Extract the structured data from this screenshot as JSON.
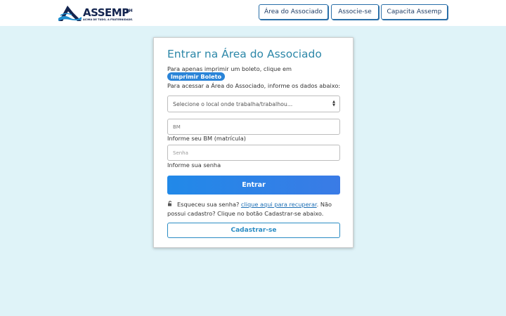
{
  "header": {
    "logo": {
      "wordmark": "ASSEMP",
      "suffix": "BH",
      "tagline": "ACIMA DE TUDO, A FRATERNIDADE."
    },
    "nav": [
      "Área do Associado",
      "Associe-se",
      "Capacita Assemp"
    ]
  },
  "login": {
    "title": "Entrar na Área do Associado",
    "boleto_prompt": "Para apenas imprimir um boleto, clique em",
    "boleto_button": "Imprimir Boleto",
    "access_prompt": "Para acessar a Área do Associado, informe os dados abaixo:",
    "location_select": {
      "selected": "Selecione o local onde trabalha/trabalhou..."
    },
    "bm_input": {
      "placeholder": "BM",
      "hint": "Informe seu BM (matrícula)"
    },
    "password_input": {
      "placeholder": "Senha",
      "hint": "Informe sua senha"
    },
    "submit_label": "Entrar",
    "forgot": {
      "prefix": "Esqueceu sua senha?",
      "link": "clique aqui para recuperar",
      "suffix": ". Não possui cadastro? Clique no botão Cadastrar-se abaixo."
    },
    "register_label": "Cadastrar-se"
  },
  "colors": {
    "background": "#dff3f8",
    "title": "#2c87a8",
    "primary_button": "#2189e8",
    "pill": "#2a84d8",
    "nav_border": "#2a6fa8",
    "brand_navy": "#13244f"
  }
}
